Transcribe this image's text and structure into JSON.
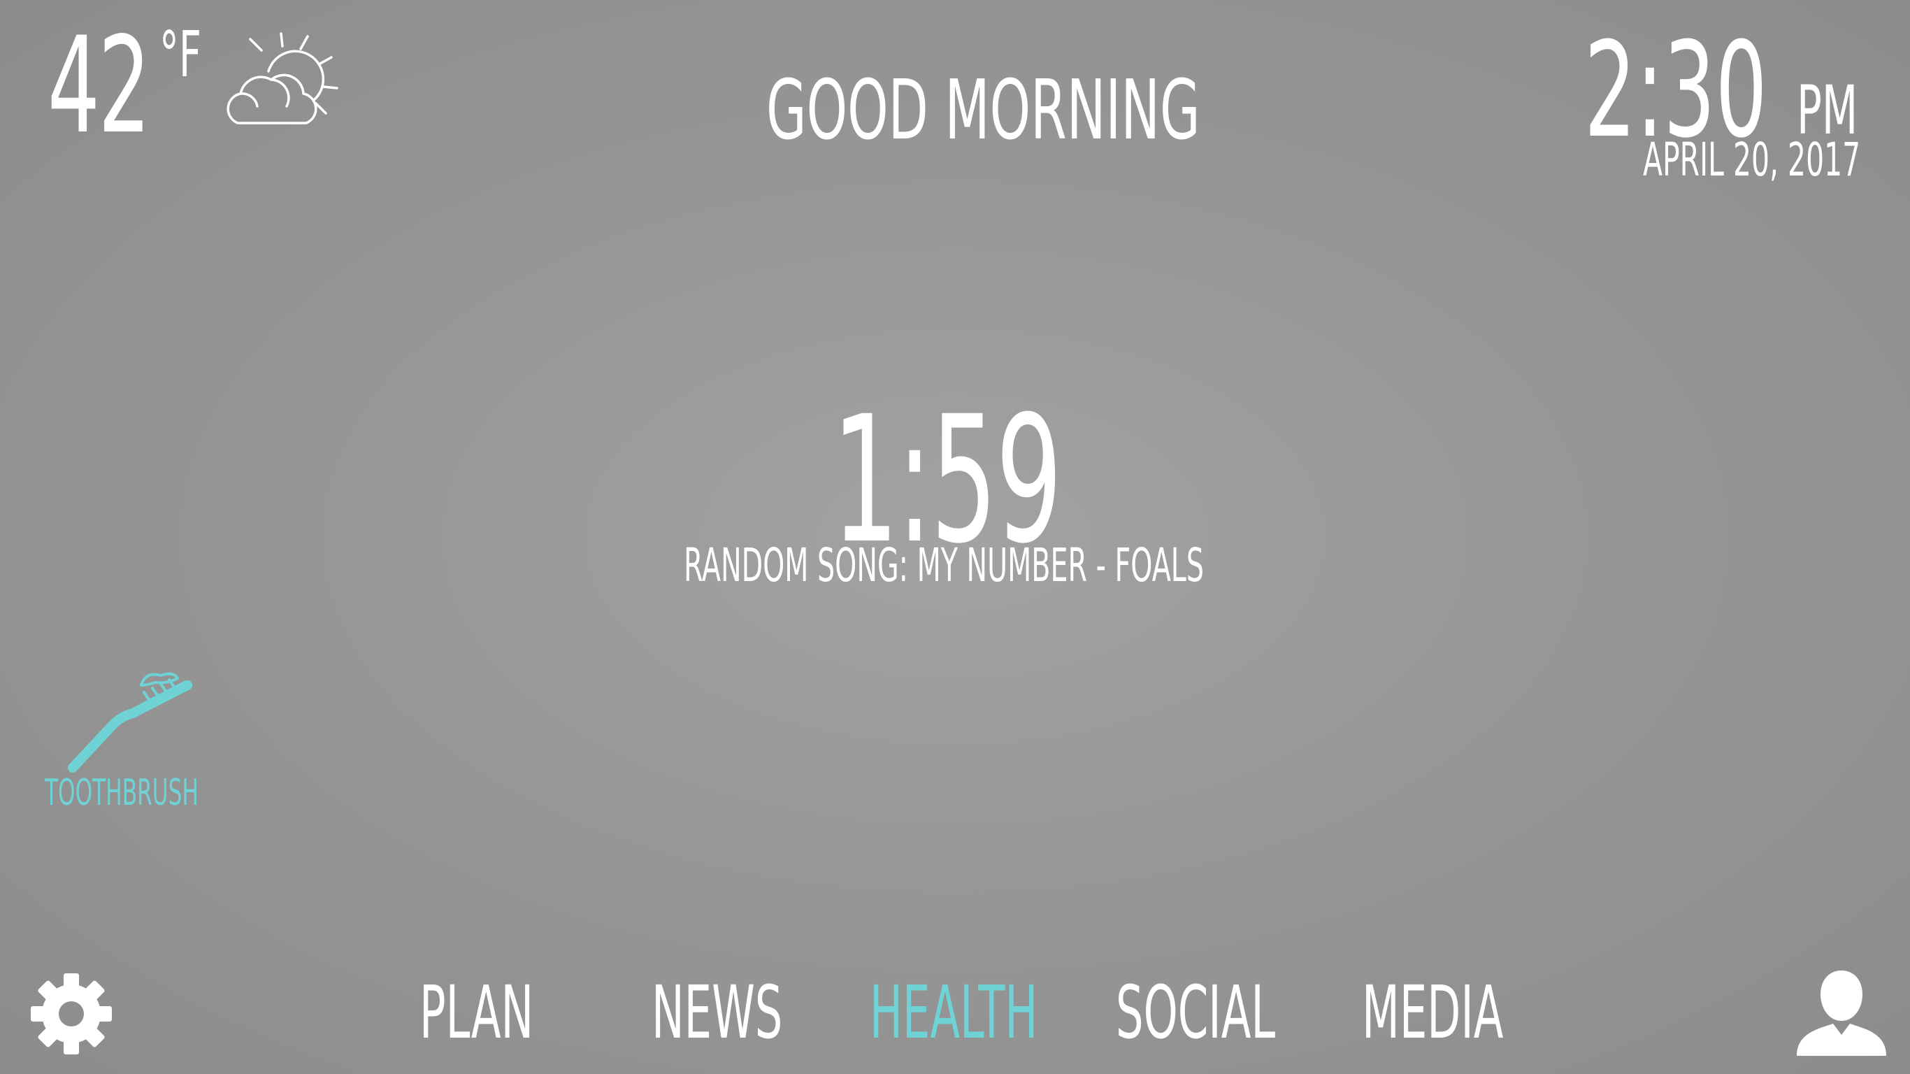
{
  "weather": {
    "temperature": "42",
    "unit": "°F",
    "icon": "partly-cloudy-icon"
  },
  "greeting": "GOOD MORNING",
  "clock": {
    "time": "2:30",
    "ampm": "PM",
    "date": "APRIL 20, 2017"
  },
  "timer": {
    "value": "1:59",
    "song": "RANDOM SONG: MY NUMBER - FOALS"
  },
  "widgets": {
    "toothbrush": {
      "label": "TOOTHBRUSH",
      "icon": "toothbrush-icon"
    }
  },
  "nav": {
    "items": [
      {
        "label": "PLAN"
      },
      {
        "label": "NEWS"
      },
      {
        "label": "HEALTH",
        "active": true
      },
      {
        "label": "SOCIAL"
      },
      {
        "label": "MEDIA"
      }
    ]
  },
  "icons": {
    "settings": "gear-icon",
    "profile": "user-icon"
  },
  "colors": {
    "accent": "#6fd3d6",
    "text": "#ffffff",
    "background": "#999999"
  }
}
